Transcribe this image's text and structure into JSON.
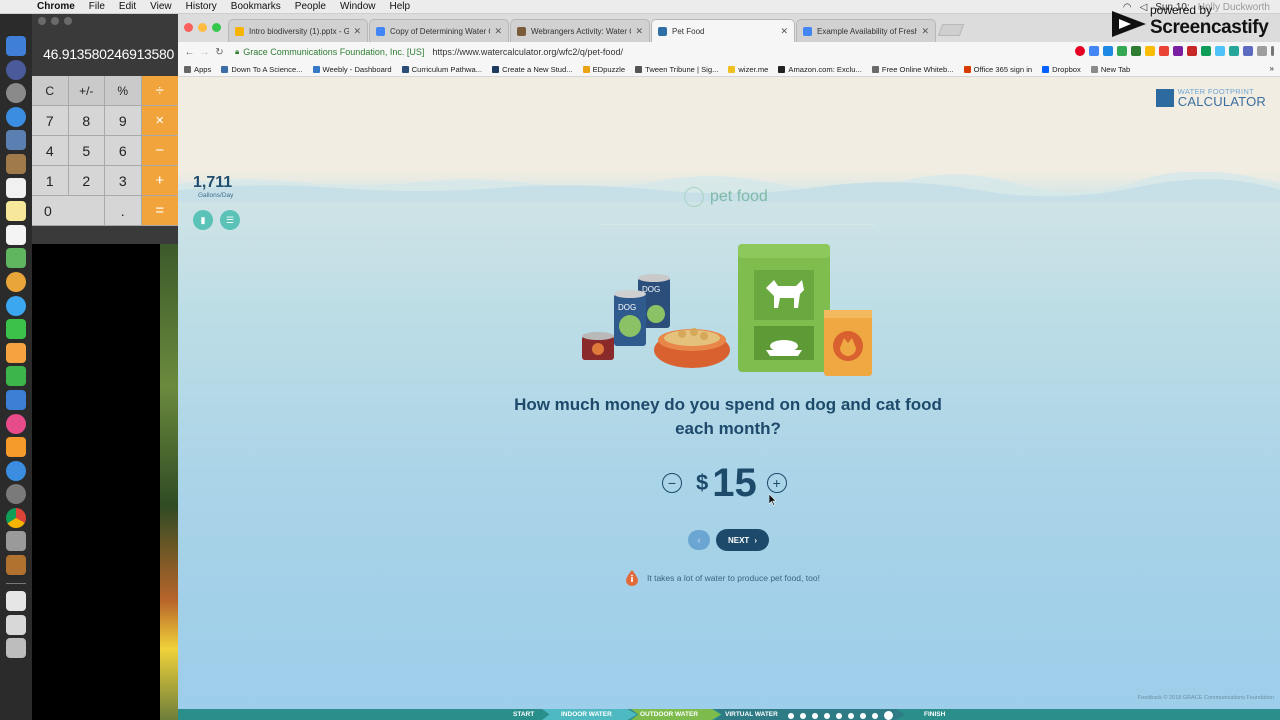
{
  "menubar": {
    "app_name": "Chrome",
    "items": [
      "File",
      "Edit",
      "View",
      "History",
      "Bookmarks",
      "People",
      "Window",
      "Help"
    ],
    "clock": "Sun 10:",
    "user": "Holly Duckworth"
  },
  "calculator": {
    "display": "46.913580246913580",
    "keys": [
      "C",
      "+/-",
      "%",
      "÷",
      "7",
      "8",
      "9",
      "×",
      "4",
      "5",
      "6",
      "−",
      "1",
      "2",
      "3",
      "+",
      "0",
      ".",
      "="
    ]
  },
  "tabs": [
    {
      "title": "Intro biodiversity (1).pptx - Go",
      "color": "#f4b400"
    },
    {
      "title": "Copy of Determining Water Qu",
      "color": "#4285f4"
    },
    {
      "title": "Webrangers Activity: Water Qu",
      "color": "#7a5c3a"
    },
    {
      "title": "Pet Food",
      "color": "#2f6fa5"
    },
    {
      "title": "Example Availability of Fresh W",
      "color": "#4285f4"
    }
  ],
  "address_bar": {
    "site_identity": "Grace Communications Foundation, Inc. [US]",
    "url": "https://www.watercalculator.org/wfc2/q/pet-food/"
  },
  "bookmarks": [
    {
      "label": "Apps",
      "color": "#666666"
    },
    {
      "label": "Down To A Science...",
      "color": "#3b6ea5"
    },
    {
      "label": "Weebly - Dashboard",
      "color": "#3578c6"
    },
    {
      "label": "Curriculum Pathwa...",
      "color": "#2a4d7a"
    },
    {
      "label": "Create a New Stud...",
      "color": "#1e3a5f"
    },
    {
      "label": "EDpuzzle",
      "color": "#e8a317"
    },
    {
      "label": "Tween Tribune | Sig...",
      "color": "#555555"
    },
    {
      "label": "wizer.me",
      "color": "#f0c020"
    },
    {
      "label": "Amazon.com: Exclu...",
      "color": "#222222"
    },
    {
      "label": "Free Online Whiteb...",
      "color": "#6a6a6a"
    },
    {
      "label": "Office 365 sign in",
      "color": "#d83b01"
    },
    {
      "label": "Dropbox",
      "color": "#0061ff"
    },
    {
      "label": "New Tab",
      "color": "#8a8a8a"
    }
  ],
  "page": {
    "logo_line1": "WATER FOOTPRINT",
    "logo_line2": "CALCULATOR",
    "gallons_value": "1,711",
    "gallons_unit": "Gallons/Day",
    "section_title": "pet food",
    "question": "How much money do you spend on dog and cat food each month?",
    "currency_symbol": "$",
    "amount": "15",
    "next_label": "NEXT",
    "tip": "It takes a lot of water to produce pet food, too!",
    "footer_feedback": "Feedback",
    "footer_copyright": "© 2018 GRACE Communications Foundation",
    "can_label": "DOG"
  },
  "progress": {
    "steps": [
      "START",
      "INDOOR WATER",
      "OUTDOOR WATER",
      "VIRTUAL WATER",
      "FINISH"
    ],
    "virtual_dots_total": 9,
    "virtual_dots_current": 9
  },
  "watermark": {
    "powered_by": "powered by",
    "brand": "Screencastify"
  },
  "colors": {
    "navy": "#1d4a6b",
    "teal": "#5bc2b8",
    "progress_bar": "#2a8e8b",
    "accent_orange": "#f1a33c"
  }
}
